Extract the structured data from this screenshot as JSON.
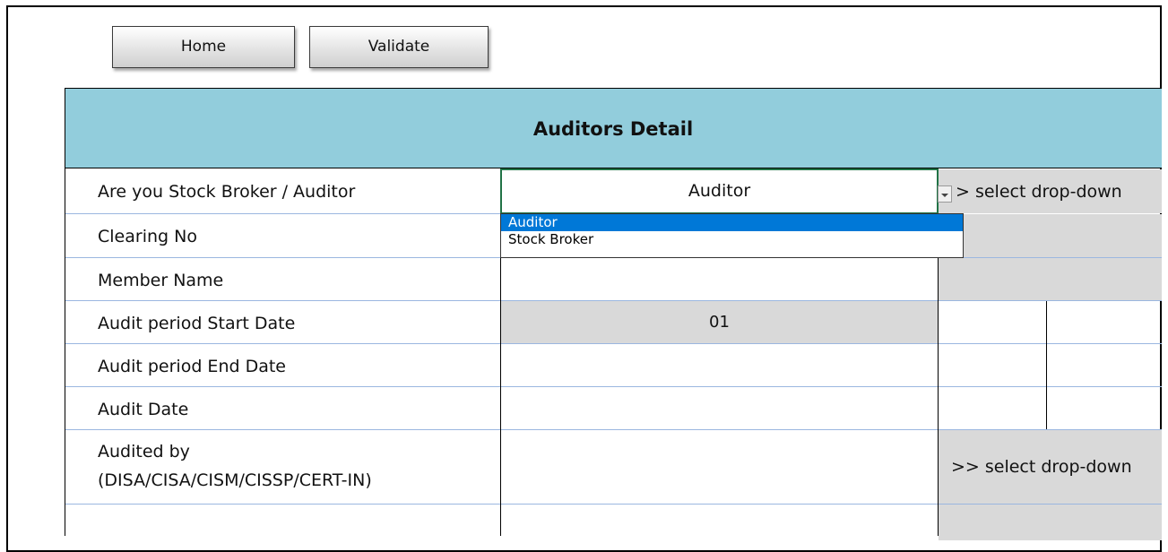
{
  "toolbar": {
    "home_label": "Home",
    "validate_label": "Validate"
  },
  "sheet": {
    "title": "Auditors Detail",
    "rows": [
      {
        "label": "Are you Stock Broker / Auditor"
      },
      {
        "label": "Clearing No"
      },
      {
        "label": "Member Name"
      },
      {
        "label": "Audit period Start Date"
      },
      {
        "label": "Audit period End Date"
      },
      {
        "label": "Audit Date"
      },
      {
        "label": "Audited by",
        "label2": "(DISA/CISA/CISM/CISSP/CERT-IN)"
      }
    ],
    "selected_value": "Auditor",
    "start_date_value": "01",
    "hint_row1": "> select drop-down",
    "hint_audited": ">> select drop-down"
  },
  "dropdown": {
    "options": [
      "Auditor",
      "Stock Broker"
    ],
    "selected_index": 0
  }
}
